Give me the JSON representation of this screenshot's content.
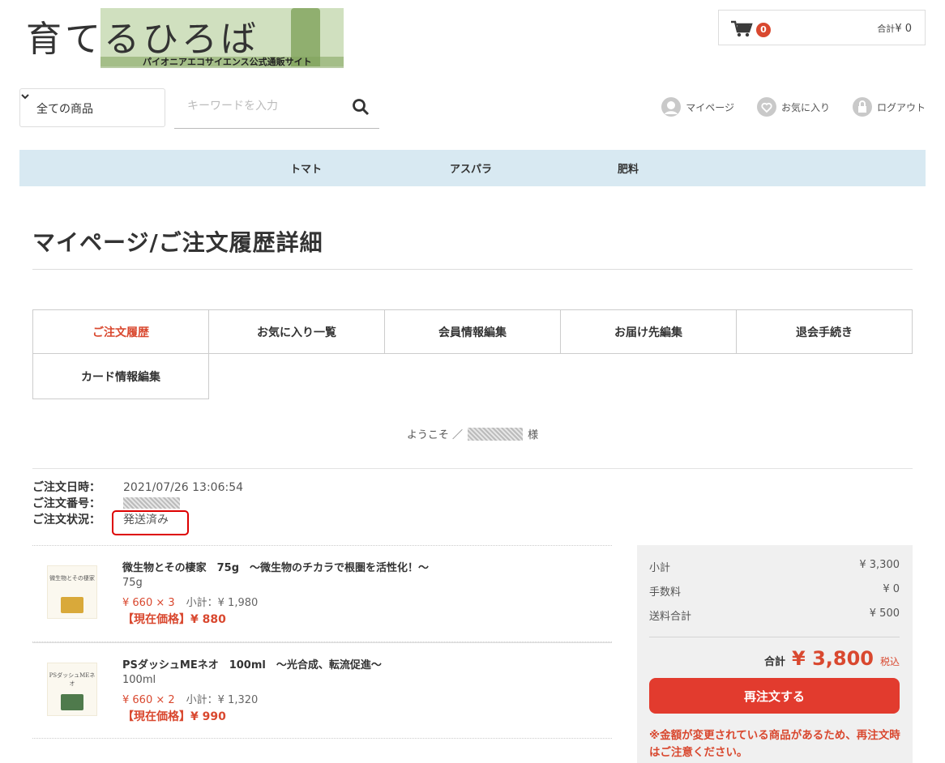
{
  "header": {
    "logo_title": "育てるひろば",
    "logo_subtitle": "パイオニアエコサイエンス公式通販サイト",
    "cart_count": "0",
    "cart_total_label": "合計",
    "cart_total_value": "¥ 0"
  },
  "search": {
    "category": "全ての商品",
    "placeholder": "キーワードを入力"
  },
  "user_links": {
    "mypage": "マイページ",
    "favorites": "お気に入り",
    "logout": "ログアウト"
  },
  "nav": [
    "トマト",
    "アスパラ",
    "肥料"
  ],
  "page_title": "マイページ/ご注文履歴詳細",
  "tabs": [
    "ご注文履歴",
    "お気に入り一覧",
    "会員情報編集",
    "お届け先編集",
    "退会手続き",
    "カード情報編集"
  ],
  "welcome": {
    "prefix": "ようこそ ／",
    "suffix": "様"
  },
  "order": {
    "date_label": "ご注文日時：",
    "date_value": "2021/07/26 13:06:54",
    "number_label": "ご注文番号：",
    "status_label": "ご注文状況：",
    "status_value": "発送済み"
  },
  "items": [
    {
      "thumb_text": "微生物とその棲家",
      "name": "微生物とその棲家　75g　～微生物のチカラで根圏を活性化！～",
      "volume": "75g",
      "price": "¥ 660 × 3",
      "subtotal": "小計：¥ 1,980",
      "current_price": "【現在価格】¥ 880"
    },
    {
      "thumb_text": "PSダッシュMEネオ",
      "name": "PSダッシュMEネオ　100ml　～光合成、転流促進～",
      "volume": "100ml",
      "price": "¥ 660 × 2",
      "subtotal": "小計：¥ 1,320",
      "current_price": "【現在価格】¥ 990"
    }
  ],
  "summary": {
    "subtotal_label": "小計",
    "subtotal_value": "¥ 3,300",
    "fee_label": "手数料",
    "fee_value": "¥ 0",
    "shipping_label": "送料合計",
    "shipping_value": "¥ 500",
    "total_label": "合計",
    "total_value": "¥ 3,800",
    "tax_label": "税込",
    "reorder_button": "再注文する",
    "note": "※金額が変更されている商品があるため、再注文時はご注意ください。"
  },
  "colors": {
    "accent": "#d9482f",
    "nav_bg": "#d8e9f2",
    "button": "#e23b2e"
  }
}
